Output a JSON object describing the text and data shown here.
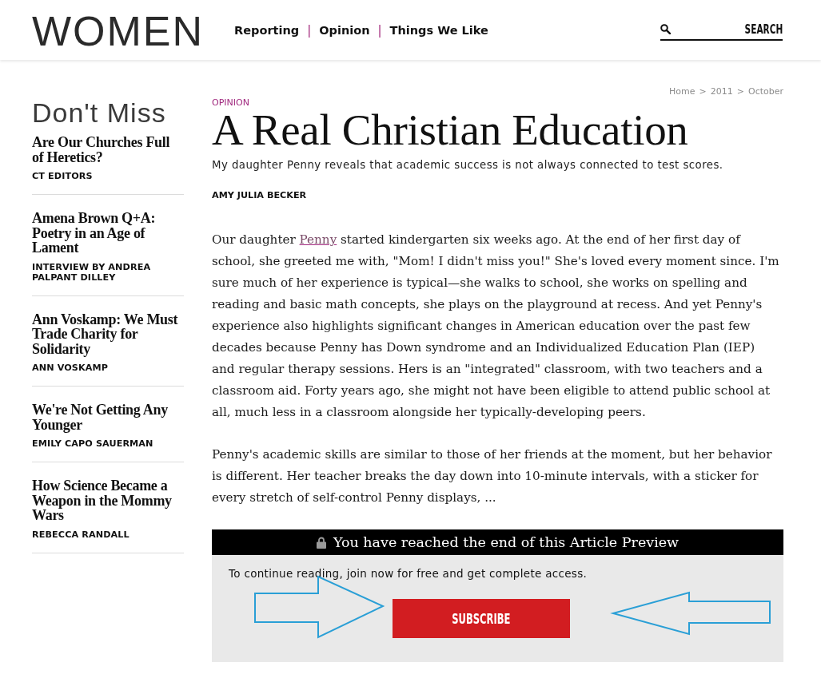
{
  "header": {
    "logo": "WOMEN",
    "nav": {
      "items": [
        "Reporting",
        "Opinion",
        "Things We Like"
      ],
      "separator": "|"
    },
    "search": {
      "button": "SEARCH"
    }
  },
  "sidebar": {
    "heading": "Don't Miss",
    "items": [
      {
        "title": "Are Our Churches Full of Heretics?",
        "author": "CT EDITORS"
      },
      {
        "title": "Amena Brown Q+A: Poetry in an Age of Lament",
        "author": "INTERVIEW BY ANDREA PALPANT DILLEY"
      },
      {
        "title": "Ann Voskamp: We Must Trade Charity for Solidarity",
        "author": "ANN VOSKAMP"
      },
      {
        "title": "We're Not Getting Any Younger",
        "author": "EMILY CAPO SAUERMAN"
      },
      {
        "title": "How Science Became a Weapon in the Mommy Wars",
        "author": "REBECCA RANDALL"
      }
    ]
  },
  "breadcrumb": {
    "items": [
      "Home",
      "2011",
      "October"
    ],
    "separator": ">"
  },
  "article": {
    "section": "OPINION",
    "title": "A Real Christian Education",
    "dek": "My daughter Penny reveals that academic success is not always connected to test scores.",
    "author": "AMY JULIA BECKER",
    "paragraphs": [
      {
        "segments": [
          {
            "kind": "text",
            "text": "Our daughter "
          },
          {
            "kind": "link",
            "text": "Penny"
          },
          {
            "kind": "text",
            "text": " started kindergarten six weeks ago. At the end of her first day of school, she greeted me with, \"Mom! I didn't miss you!\" She's loved every moment since. I'm sure much of her experience is typical—she walks to school, she works on spelling and reading and basic math concepts, she plays on the playground at recess. And yet Penny's experience also highlights significant changes in American education over the past few decades because Penny has Down syndrome and an Individualized Education Plan (IEP) and regular therapy sessions. Hers is an \"integrated\" classroom, with two teachers and a classroom aid. Forty years ago, she might not have been eligible to attend public school at all, much less in a classroom alongside her typically-developing peers."
          }
        ]
      },
      {
        "segments": [
          {
            "kind": "text",
            "text": "Penny's academic skills are similar to those of her friends at the moment, but her behavior is different. Her teacher breaks the day down into 10-minute intervals, with a sticker for every stretch of self-control Penny displays, ..."
          }
        ]
      }
    ]
  },
  "paywall": {
    "heading": "You have reached the end of this Article Preview",
    "message": "To continue reading, join now for free and get complete access.",
    "button": "SUBSCRIBE"
  }
}
